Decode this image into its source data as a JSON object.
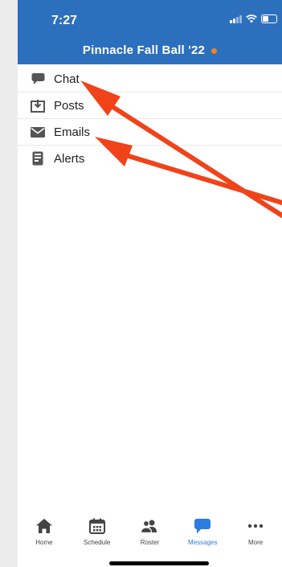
{
  "status_bar": {
    "time": "7:27"
  },
  "header": {
    "title": "Pinnacle Fall Ball '22"
  },
  "menu": [
    {
      "label": "Chat",
      "icon": "chat-bubble-icon"
    },
    {
      "label": "Posts",
      "icon": "posts-icon"
    },
    {
      "label": "Emails",
      "icon": "envelope-icon"
    },
    {
      "label": "Alerts",
      "icon": "alerts-icon"
    }
  ],
  "tabs": [
    {
      "label": "Home",
      "icon": "home-icon"
    },
    {
      "label": "Schedule",
      "icon": "calendar-icon"
    },
    {
      "label": "Roster",
      "icon": "people-icon"
    },
    {
      "label": "Messages",
      "icon": "message-bubble-icon",
      "active": true
    },
    {
      "label": "More",
      "icon": "more-dots-icon"
    }
  ],
  "colors": {
    "header": "#2c6fbd",
    "accent": "#2c7de0",
    "unread_dot": "#f5821f",
    "annotation_arrow": "#f0431a"
  }
}
